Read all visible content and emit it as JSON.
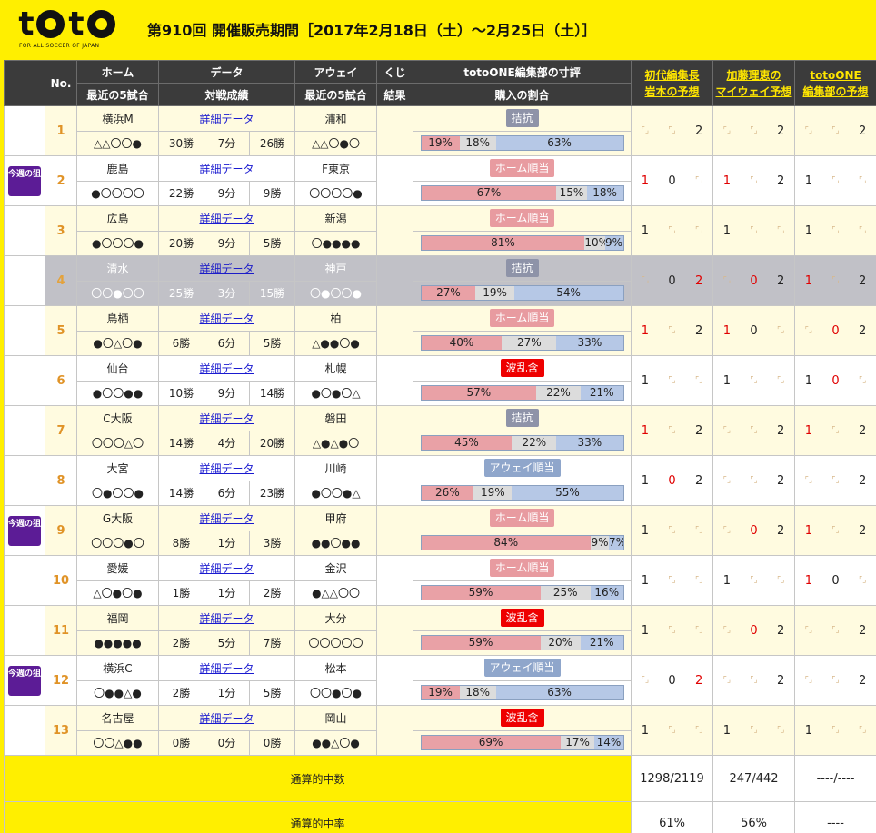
{
  "header": {
    "logo_text": "toto",
    "logo_tagline": "FOR ALL SOCCER OF JAPAN",
    "title": "第910回 開催販売期間［2017年2月18日（土）～2月25日（土）］"
  },
  "columns": {
    "no": "No.",
    "home": "ホーム",
    "home_sub": "最近の5試合",
    "data": "データ",
    "data_sub": "対戦成績",
    "away": "アウェイ",
    "away_sub": "最近の5試合",
    "kuji": "くじ",
    "kuji_sub": "結果",
    "editor": "totoONE編集部の寸評",
    "editor_sub": "購入の割合",
    "pred1_l1": "初代編集長",
    "pred1_l2": "岩本の予想",
    "pred2_l1": "加藤理恵の",
    "pred2_l2": "マイウェイ予想",
    "pred3_l1": "totoONE",
    "pred3_l2": "編集部の予想"
  },
  "badge_text": "今週の狙い目",
  "matches": [
    {
      "no": "1",
      "home": "横浜M",
      "home_form": "△△〇〇●",
      "data_link": "詳細データ",
      "w": "30勝",
      "d": "7分",
      "l": "26勝",
      "away": "浦和",
      "away_form": "△△〇●〇",
      "verdict": "拮抗",
      "vtype": "kikkou",
      "pct": [
        19,
        18,
        63
      ],
      "pct_text": [
        "19%",
        "18%",
        "63%"
      ],
      "p1": [
        "",
        "",
        "2"
      ],
      "p2": [
        "",
        "",
        "2"
      ],
      "p3": [
        "",
        "",
        "2"
      ],
      "badge": false
    },
    {
      "no": "2",
      "home": "鹿島",
      "home_form": "●〇〇〇〇",
      "data_link": "詳細データ",
      "w": "22勝",
      "d": "9分",
      "l": "9勝",
      "away": "F東京",
      "away_form": "〇〇〇〇●",
      "verdict": "ホーム順当",
      "vtype": "home",
      "pct": [
        67,
        15,
        18
      ],
      "pct_text": [
        "67%",
        "15%",
        "18%"
      ],
      "p1": [
        "1r",
        "0",
        ""
      ],
      "p2": [
        "1r",
        "",
        "2"
      ],
      "p3": [
        "1",
        "",
        ""
      ],
      "badge": true
    },
    {
      "no": "3",
      "home": "広島",
      "home_form": "●〇〇〇●",
      "data_link": "詳細データ",
      "w": "20勝",
      "d": "9分",
      "l": "5勝",
      "away": "新潟",
      "away_form": "〇●●●●",
      "verdict": "ホーム順当",
      "vtype": "home",
      "pct": [
        81,
        10,
        9
      ],
      "pct_text": [
        "81%",
        "10%",
        "9%"
      ],
      "p1": [
        "1",
        "",
        ""
      ],
      "p2": [
        "1",
        "",
        ""
      ],
      "p3": [
        "1",
        "",
        ""
      ],
      "badge": false
    },
    {
      "no": "4",
      "home": "清水",
      "home_form": "〇〇●〇〇",
      "data_link": "詳細データ",
      "w": "25勝",
      "d": "3分",
      "l": "15勝",
      "away": "神戸",
      "away_form": "〇●〇〇●",
      "verdict": "拮抗",
      "vtype": "kikkou",
      "pct": [
        27,
        19,
        54
      ],
      "pct_text": [
        "27%",
        "19%",
        "54%"
      ],
      "p1": [
        "",
        "0",
        "2r"
      ],
      "p2": [
        "",
        "0r",
        "2"
      ],
      "p3": [
        "1r",
        "",
        "2"
      ],
      "badge": false,
      "gray": true
    },
    {
      "no": "5",
      "home": "鳥栖",
      "home_form": "●〇△〇●",
      "data_link": "詳細データ",
      "w": "6勝",
      "d": "6分",
      "l": "5勝",
      "away": "柏",
      "away_form": "△●●〇●",
      "verdict": "ホーム順当",
      "vtype": "home",
      "pct": [
        40,
        27,
        33
      ],
      "pct_text": [
        "40%",
        "27%",
        "33%"
      ],
      "p1": [
        "1r",
        "",
        "2"
      ],
      "p2": [
        "1r",
        "0",
        ""
      ],
      "p3": [
        "",
        "0r",
        "2"
      ],
      "badge": false
    },
    {
      "no": "6",
      "home": "仙台",
      "home_form": "●〇〇●●",
      "data_link": "詳細データ",
      "w": "10勝",
      "d": "9分",
      "l": "14勝",
      "away": "札幌",
      "away_form": "●〇●〇△",
      "verdict": "波乱含",
      "vtype": "haran",
      "pct": [
        57,
        22,
        21
      ],
      "pct_text": [
        "57%",
        "22%",
        "21%"
      ],
      "p1": [
        "1",
        "",
        ""
      ],
      "p2": [
        "1",
        "",
        ""
      ],
      "p3": [
        "1",
        "0r",
        ""
      ],
      "badge": false
    },
    {
      "no": "7",
      "home": "C大阪",
      "home_form": "〇〇〇△〇",
      "data_link": "詳細データ",
      "w": "14勝",
      "d": "4分",
      "l": "20勝",
      "away": "磐田",
      "away_form": "△●△●〇",
      "verdict": "拮抗",
      "vtype": "kikkou",
      "pct": [
        45,
        22,
        33
      ],
      "pct_text": [
        "45%",
        "22%",
        "33%"
      ],
      "p1": [
        "1r",
        "",
        "2"
      ],
      "p2": [
        "",
        "",
        "2"
      ],
      "p3": [
        "1r",
        "",
        "2"
      ],
      "badge": false
    },
    {
      "no": "8",
      "home": "大宮",
      "home_form": "〇●〇〇●",
      "data_link": "詳細データ",
      "w": "14勝",
      "d": "6分",
      "l": "23勝",
      "away": "川崎",
      "away_form": "●〇〇●△",
      "verdict": "アウェイ順当",
      "vtype": "away",
      "pct": [
        26,
        19,
        55
      ],
      "pct_text": [
        "26%",
        "19%",
        "55%"
      ],
      "p1": [
        "1",
        "0r",
        "2"
      ],
      "p2": [
        "",
        "",
        "2"
      ],
      "p3": [
        "",
        "",
        "2"
      ],
      "badge": false
    },
    {
      "no": "9",
      "home": "G大阪",
      "home_form": "〇〇〇●〇",
      "data_link": "詳細データ",
      "w": "8勝",
      "d": "1分",
      "l": "3勝",
      "away": "甲府",
      "away_form": "●●〇●●",
      "verdict": "ホーム順当",
      "vtype": "home",
      "pct": [
        84,
        9,
        7
      ],
      "pct_text": [
        "84%",
        "9%",
        "7%"
      ],
      "p1": [
        "1",
        "",
        ""
      ],
      "p2": [
        "",
        "0r",
        "2"
      ],
      "p3": [
        "1r",
        "",
        "2"
      ],
      "badge": true
    },
    {
      "no": "10",
      "home": "愛媛",
      "home_form": "△〇●〇●",
      "data_link": "詳細データ",
      "w": "1勝",
      "d": "1分",
      "l": "2勝",
      "away": "金沢",
      "away_form": "●△△〇〇",
      "verdict": "ホーム順当",
      "vtype": "home",
      "pct": [
        59,
        25,
        16
      ],
      "pct_text": [
        "59%",
        "25%",
        "16%"
      ],
      "p1": [
        "1",
        "",
        ""
      ],
      "p2": [
        "1",
        "",
        ""
      ],
      "p3": [
        "1r",
        "0",
        ""
      ],
      "badge": false
    },
    {
      "no": "11",
      "home": "福岡",
      "home_form": "●●●●●",
      "data_link": "詳細データ",
      "w": "2勝",
      "d": "5分",
      "l": "7勝",
      "away": "大分",
      "away_form": "〇〇〇〇〇",
      "verdict": "波乱含",
      "vtype": "haran",
      "pct": [
        59,
        20,
        21
      ],
      "pct_text": [
        "59%",
        "20%",
        "21%"
      ],
      "p1": [
        "1",
        "",
        ""
      ],
      "p2": [
        "",
        "0r",
        "2"
      ],
      "p3": [
        "",
        "",
        "2"
      ],
      "badge": false
    },
    {
      "no": "12",
      "home": "横浜C",
      "home_form": "〇●●△●",
      "data_link": "詳細データ",
      "w": "2勝",
      "d": "1分",
      "l": "5勝",
      "away": "松本",
      "away_form": "〇〇●〇●",
      "verdict": "アウェイ順当",
      "vtype": "away",
      "pct": [
        19,
        18,
        63
      ],
      "pct_text": [
        "19%",
        "18%",
        "63%"
      ],
      "p1": [
        "",
        "0",
        "2r"
      ],
      "p2": [
        "",
        "",
        "2"
      ],
      "p3": [
        "",
        "",
        "2"
      ],
      "badge": true
    },
    {
      "no": "13",
      "home": "名古屋",
      "home_form": "〇〇△●●",
      "data_link": "詳細データ",
      "w": "0勝",
      "d": "0分",
      "l": "0勝",
      "away": "岡山",
      "away_form": "●●△〇●",
      "verdict": "波乱含",
      "vtype": "haran",
      "pct": [
        69,
        17,
        14
      ],
      "pct_text": [
        "69%",
        "17%",
        "14%"
      ],
      "p1": [
        "1",
        "",
        ""
      ],
      "p2": [
        "1",
        "",
        ""
      ],
      "p3": [
        "1",
        "",
        ""
      ],
      "badge": false
    }
  ],
  "totals": {
    "count_label": "通算的中数",
    "count_vals": [
      "1298/2119",
      "247/442",
      "----/----"
    ],
    "rate_label": "通算的中率",
    "rate_vals": [
      "61%",
      "56%",
      "----"
    ]
  },
  "colors": {
    "yellow": "#ffef00",
    "header_dark": "#3b3b3b",
    "badge_purple": "#5c1c96",
    "home_pink": "#e9a1a6",
    "away_blue": "#b6c8e6",
    "pred_red": "#e00000",
    "number_orange": "#e09327"
  }
}
